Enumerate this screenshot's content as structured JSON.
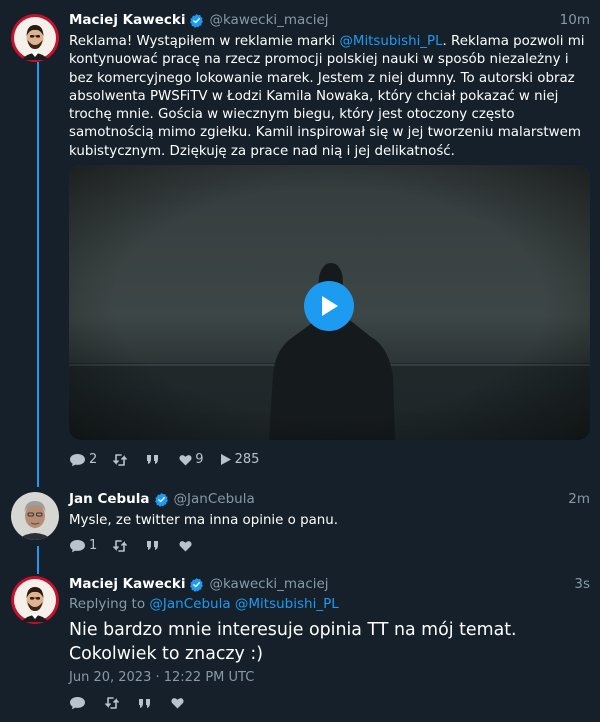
{
  "tweets": [
    {
      "name": "Maciej Kawecki",
      "handle": "@kawecki_maciej",
      "time": "10m",
      "text_parts": [
        "Reklama! Wystąpiłem w reklamie marki ",
        "@Mitsubishi_PL",
        ". Reklama pozwoli mi kontynuować pracę na rzecz promocji polskiej nauki w sposób niezależny i bez komercyjnego lokowanie marek. Jestem z niej dumny. To autorski obraz absolwenta PWSFiTV w Łodzi Kamila Nowaka, który chciał pokazać w niej trochę mnie. Gościa w wiecznym biegu, który jest otoczony często samotnością mimo zgiełku. Kamil inspirował się w jej tworzeniu malarstwem kubistycznym. Dziękuję za prace nad nią i jej delikatność."
      ],
      "replies": "2",
      "likes": "9",
      "views": "285"
    },
    {
      "name": "Jan Cebula",
      "handle": "@JanCebula",
      "time": "2m",
      "text": "Mysle, ze twitter ma inna opinie o panu.",
      "replies": "1"
    },
    {
      "name": "Maciej Kawecki",
      "handle": "@kawecki_maciej",
      "time": "3s",
      "replying_prefix": "Replying to ",
      "replying_to": "@JanCebula @Mitsubishi_PL",
      "text": "Nie bardzo mnie interesuje opinia TT na mój temat. Cokolwiek to znaczy :)",
      "date": "Jun 20, 2023 · 12:22 PM UTC"
    }
  ],
  "colors": {
    "background": "#15202b",
    "accent": "#1d9bf0",
    "muted": "#8899a6"
  },
  "icons": [
    "verified-icon",
    "reply-icon",
    "retweet-icon",
    "quote-icon",
    "like-icon",
    "views-icon",
    "play-icon"
  ]
}
